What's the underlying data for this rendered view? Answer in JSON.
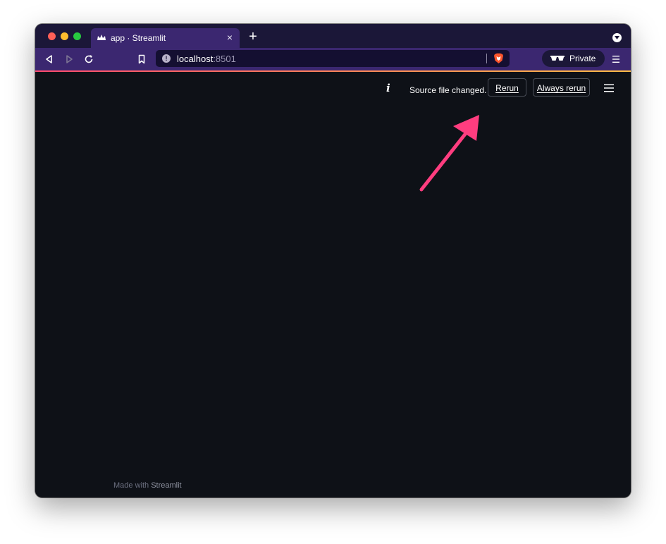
{
  "browser": {
    "tab": {
      "title": "app · Streamlit",
      "close_glyph": "×"
    },
    "new_tab_glyph": "+",
    "url": {
      "host": "localhost",
      "port": ":8501"
    },
    "private_label": "Private",
    "icons": {
      "back": "back-icon",
      "forward": "forward-icon",
      "reload": "reload-icon",
      "bookmark": "bookmark-icon",
      "site_info": "info-icon",
      "brave_shields": "brave-shield-icon",
      "private": "private-glasses-icon",
      "menu": "hamburger-menu-icon"
    },
    "colors": {
      "tabbar": "#1b1738",
      "toolbar": "#3b2770",
      "urlbar": "#140f31"
    }
  },
  "app": {
    "status": {
      "icon_glyph": "i",
      "message": "Source file changed."
    },
    "buttons": {
      "rerun": "Rerun",
      "always_rerun": "Always rerun"
    },
    "footer": {
      "made_with": "Made with",
      "brand": "Streamlit"
    },
    "annotation_color": "#ff3d7f",
    "colors": {
      "background": "#0e1117",
      "accent_start": "#ff4b6e",
      "accent_end": "#ffbd45"
    }
  }
}
